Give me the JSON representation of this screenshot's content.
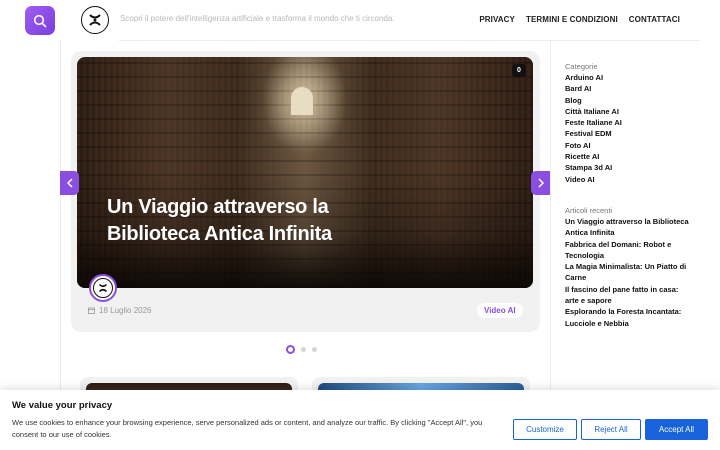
{
  "header": {
    "tagline": "Scopri il potere dell'intelligenza artificiale e trasforma il mondo che ti circonda.",
    "nav": [
      "PRIVACY",
      "TERMINI E CONDIZIONI",
      "CONTATTACI"
    ]
  },
  "slider": {
    "title": "Un Viaggio attraverso la Biblioteca Antica Infinita",
    "comment_count": "0",
    "date": "18 Luglio 2026",
    "category": "Video AI",
    "slide_count": 3,
    "active_slide": 1
  },
  "sidebar": {
    "categories_heading": "Categorie",
    "categories": [
      "Arduino AI",
      "Bard AI",
      "Blog",
      "Città Italiane AI",
      "Feste Italiane AI",
      "Festival EDM",
      "Foto AI",
      "Ricette AI",
      "Stampa 3d AI",
      "Video AI"
    ],
    "recent_heading": "Articoli recenti",
    "recent": [
      "Un Viaggio attraverso la Biblioteca",
      "Antica Infinita",
      "Fabbrica del Domani: Robot e",
      "Tecnologia",
      "La Magia Minimalista: Un Piatto di",
      "Carne",
      "Il fascino del pane fatto in casa:",
      "arte e sapore",
      "Esplorando la Foresta Incantata:",
      "Lucciole e Nebbia"
    ]
  },
  "cookie": {
    "title": "We value your privacy",
    "text": "We use cookies to enhance your browsing experience, serve personalized ads or content, and analyze our traffic. By clicking \"Accept All\", you consent to our use of cookies.",
    "customize": "Customize",
    "reject": "Reject All",
    "accept": "Accept All"
  },
  "colors": {
    "accent": "#8a4fe0",
    "cookie_blue": "#1863dc"
  }
}
